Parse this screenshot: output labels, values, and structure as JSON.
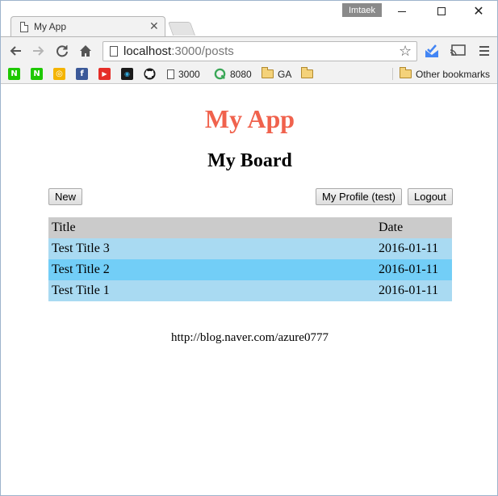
{
  "browser": {
    "tab_title": "My App",
    "profile_name": "Imtaek",
    "url_host": "localhost",
    "url_path": ":3000/posts",
    "bookmarks": [
      {
        "icon": "naver-n-icon",
        "label": "",
        "color": "#1ec800",
        "glyph": "N"
      },
      {
        "icon": "naver-n-icon",
        "label": "",
        "color": "#1ec800",
        "glyph": "N"
      },
      {
        "icon": "lightbulb-icon",
        "label": "",
        "color": "#f4b400",
        "glyph": "💡"
      },
      {
        "icon": "facebook-icon",
        "label": "",
        "color": "#3b5998",
        "glyph": "f"
      },
      {
        "icon": "youtube-icon",
        "label": "",
        "color": "#e52d27",
        "glyph": "▶"
      },
      {
        "icon": "app-icon",
        "label": "",
        "color": "#1a1a1a",
        "glyph": "◉"
      },
      {
        "icon": "github-icon",
        "label": "",
        "color": "#ffffff",
        "glyph": "●"
      },
      {
        "icon": "page-icon",
        "label": "3000"
      },
      {
        "icon": "q-icon",
        "label": "8080"
      },
      {
        "icon": "folder-icon",
        "label": "GA"
      },
      {
        "icon": "folder-icon",
        "label": ""
      },
      {
        "icon": "folder-icon",
        "label": "Other bookmarks"
      }
    ]
  },
  "page": {
    "app_title": "My App",
    "board_title": "My Board",
    "new_button": "New",
    "profile_button": "My Profile (test)",
    "logout_button": "Logout",
    "table": {
      "headers": [
        "Title",
        "Date"
      ],
      "rows": [
        {
          "title": "Test Title 3",
          "date": "2016-01-11"
        },
        {
          "title": "Test Title 2",
          "date": "2016-01-11"
        },
        {
          "title": "Test Title 1",
          "date": "2016-01-11"
        }
      ]
    },
    "footer": "http://blog.naver.com/azure0777"
  },
  "colors": {
    "app_title": "#f0624d",
    "header_row": "#cbcbcb",
    "row_light": "#a9daf2",
    "row_dark": "#72cef7"
  }
}
